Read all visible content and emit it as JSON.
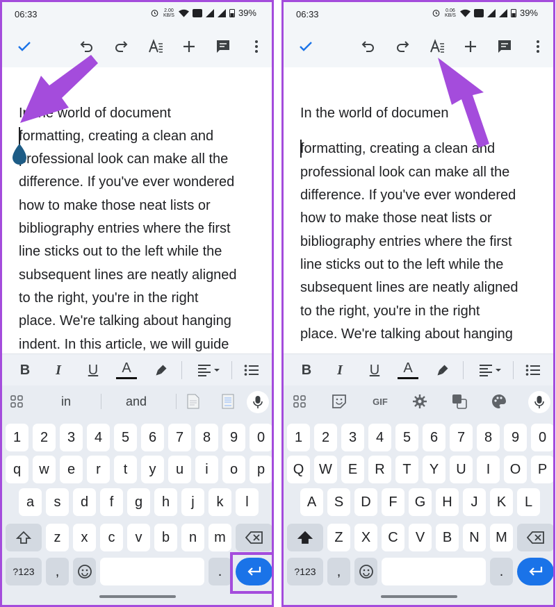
{
  "status_bar": {
    "time": "06:33",
    "left_speed": "2.00\nKB/S",
    "right_speed": "0.06\nKB/S",
    "battery": "39%"
  },
  "toolbar": {
    "icons": [
      "check-icon",
      "undo-icon",
      "redo-icon",
      "text-format-icon",
      "insert-plus-icon",
      "comment-icon",
      "more-vert-icon"
    ]
  },
  "document_left": {
    "lines": [
      "In the world of document",
      "formatting, creating a clean and",
      "professional look can make all the",
      "difference. If you've ever wondered",
      "how to make those neat lists or",
      "bibliography entries where the first",
      "line sticks out to the left while the",
      "subsequent lines are neatly aligned",
      "to the right, you're in the right",
      "place. We're talking about hanging",
      "indent. In this article, we will guide"
    ]
  },
  "document_right": {
    "lines": [
      "In the world of documen",
      "formatting, creating a clean and",
      "professional look can make all the",
      "difference. If you've ever wondered",
      "how to make those neat lists or",
      "bibliography entries where the first",
      "line sticks out to the left while the",
      "subsequent lines are neatly aligned",
      "to the right, you're in the right",
      "place. We're talking about hanging"
    ]
  },
  "format_bar": {
    "bold": "B",
    "italic": "I",
    "underline": "U",
    "text_color": "A"
  },
  "keyboard_left": {
    "suggestions": [
      "in",
      "and"
    ],
    "number_row": [
      "1",
      "2",
      "3",
      "4",
      "5",
      "6",
      "7",
      "8",
      "9",
      "0"
    ],
    "row1": [
      "q",
      "w",
      "e",
      "r",
      "t",
      "y",
      "u",
      "i",
      "o",
      "p"
    ],
    "row2": [
      "a",
      "s",
      "d",
      "f",
      "g",
      "h",
      "j",
      "k",
      "l"
    ],
    "row3": [
      "z",
      "x",
      "c",
      "v",
      "b",
      "n",
      "m"
    ],
    "symbols_label": "?123",
    "comma": ",",
    "period": "."
  },
  "keyboard_right": {
    "toolbar_icons": [
      "apps-grid-icon",
      "sticker-icon",
      "gif-icon",
      "settings-gear-icon",
      "translate-icon",
      "palette-icon",
      "mic-icon"
    ],
    "gif_label": "GIF",
    "number_row": [
      "1",
      "2",
      "3",
      "4",
      "5",
      "6",
      "7",
      "8",
      "9",
      "0"
    ],
    "row1": [
      "Q",
      "W",
      "E",
      "R",
      "T",
      "Y",
      "U",
      "I",
      "O",
      "P"
    ],
    "row2": [
      "A",
      "S",
      "D",
      "F",
      "G",
      "H",
      "J",
      "K",
      "L"
    ],
    "row3": [
      "Z",
      "X",
      "C",
      "V",
      "B",
      "N",
      "M"
    ],
    "symbols_label": "?123",
    "comma": ",",
    "period": "."
  },
  "colors": {
    "annotation": "#a44cdc",
    "accent": "#1a73e8",
    "handle": "#1d5c86"
  }
}
